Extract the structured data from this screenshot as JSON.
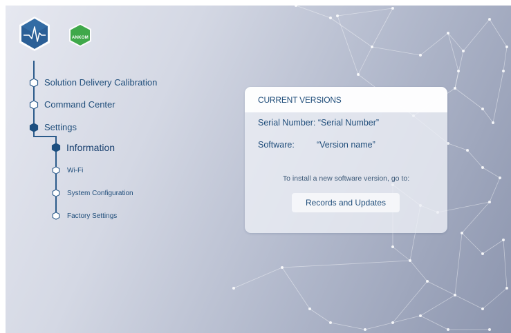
{
  "brand": {
    "ankom_logo_text": "ANKOM"
  },
  "nav": {
    "items": [
      {
        "label": "Solution Delivery Calibration",
        "active": false
      },
      {
        "label": "Command Center",
        "active": false
      },
      {
        "label": "Settings",
        "active": true
      }
    ],
    "sub_items": [
      {
        "label": "Information",
        "active": true
      },
      {
        "label": "Wi-Fi",
        "active": false
      },
      {
        "label": "System Configuration",
        "active": false
      },
      {
        "label": "Factory Settings",
        "active": false
      }
    ]
  },
  "card": {
    "title": "CURRENT VERSIONS",
    "serial_number_line": "Serial Number: “Serial Number”",
    "software_label": "Software:",
    "software_value": "“Version name”",
    "install_note": "To install a new software version, go to:",
    "records_button": "Records and Updates"
  },
  "colors": {
    "accent": "#1f4d7a",
    "logo_blue": "#2b5f96",
    "logo_green": "#3fa84a"
  },
  "icons": {
    "pulse_logo": "pulse-line-icon",
    "nav_bullet": "hexagon-icon"
  }
}
